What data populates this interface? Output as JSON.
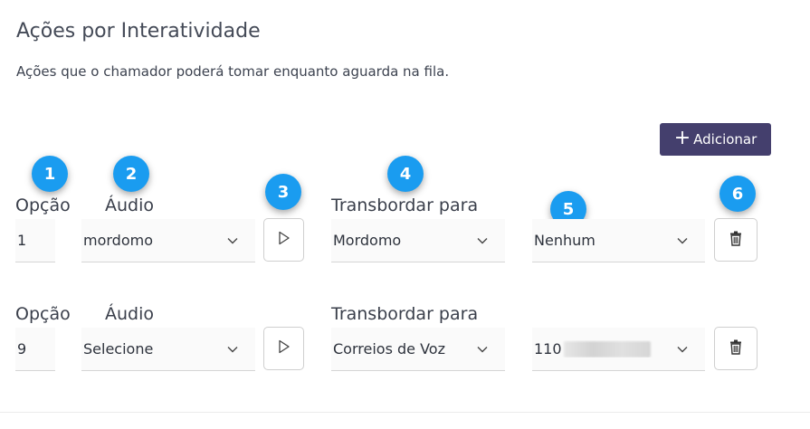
{
  "header": {
    "title": "Ações por Interatividade",
    "subtitle": "Ações que o chamador poderá tomar enquanto aguarda na fila."
  },
  "toolbar": {
    "add_label": "Adicionar",
    "add_icon": "plus-icon"
  },
  "badges": [
    "1",
    "2",
    "3",
    "4",
    "5",
    "6"
  ],
  "labels": {
    "option": "Opção",
    "audio": "Áudio",
    "overflow": "Transbordar para"
  },
  "rows": [
    {
      "option": "1",
      "audio": "mordomo",
      "overflow": "Mordomo",
      "target": "Nenhum"
    },
    {
      "option": "9",
      "audio": "Selecione",
      "overflow": "Correios de Voz",
      "target": "110"
    }
  ],
  "colors": {
    "accent_button": "#443f6d",
    "badge": "#1a9cf0"
  }
}
